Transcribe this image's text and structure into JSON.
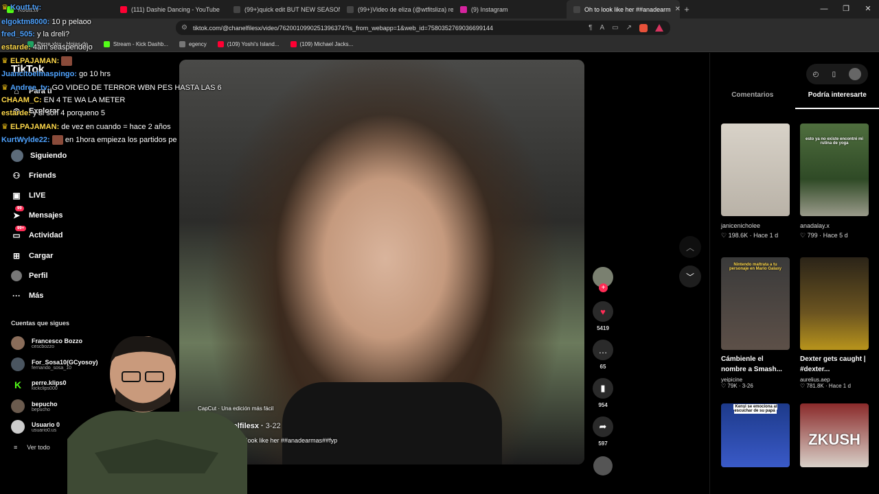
{
  "browser": {
    "tabs": [
      {
        "label": "Koutt.tv",
        "color": "#53fc18",
        "active": false
      },
      {
        "label": "(111) Dashie Dancing - YouTube",
        "color": "#ff0033",
        "active": false
      },
      {
        "label": "(99+)quick edit BUT NEW SEASON IS",
        "color": "#111111",
        "active": false
      },
      {
        "label": "(99+)Video de eliza (@wtfitsliza) relo",
        "color": "#111111",
        "active": false
      },
      {
        "label": "(9) Instagram",
        "color": "#d6249f",
        "active": false
      },
      {
        "label": "Oh to look like her ##anadearm",
        "color": "#111111",
        "active": true
      }
    ],
    "new_tab": "+",
    "window_controls": [
      "—",
      "❐",
      "✕"
    ],
    "url": "tiktok.com/@chanelfilesx/video/7620010990251396374?is_from_webapp=1&web_id=7580352769036699144",
    "bookmarks": [
      {
        "label": "Perre.xlsx - Hojas de...",
        "color": "#1fa463"
      },
      {
        "label": "Stream - Kick Dashb...",
        "color": "#53fc18"
      },
      {
        "label": "egency",
        "color": "#777777"
      },
      {
        "label": "(109) Yoshi's Island...",
        "color": "#ff0033"
      },
      {
        "label": "(109) Michael Jacks...",
        "color": "#ff0033"
      }
    ]
  },
  "tiktok": {
    "logo": "TikTok",
    "nav": [
      {
        "label": "Para ti",
        "icon": "home-icon",
        "glyph": "⌂"
      },
      {
        "label": "Explorar",
        "icon": "compass-icon",
        "glyph": "◎"
      },
      {
        "label": "Siguiendo",
        "icon": "avatar-icon",
        "glyph": "●"
      },
      {
        "label": "Friends",
        "icon": "friends-icon",
        "glyph": "⚇"
      },
      {
        "label": "LIVE",
        "icon": "live-icon",
        "glyph": "▣"
      },
      {
        "label": "Mensajes",
        "icon": "paper-plane-icon",
        "glyph": "➤",
        "badge": "99"
      },
      {
        "label": "Actividad",
        "icon": "inbox-icon",
        "glyph": "▭",
        "badge": "99+"
      },
      {
        "label": "Cargar",
        "icon": "upload-icon",
        "glyph": "⊞"
      },
      {
        "label": "Perfil",
        "icon": "profile-icon",
        "glyph": "●"
      },
      {
        "label": "Más",
        "icon": "more-icon",
        "glyph": "···"
      }
    ],
    "following_label": "Cuentas que sigues",
    "accounts": [
      {
        "name": "Francesco Bozzo",
        "handle": "cescbozzo"
      },
      {
        "name": "For_Sosa10(GCyosoy)",
        "handle": "fernando_sosa_10"
      },
      {
        "name": "perre.klips0",
        "handle": "kickclips000"
      },
      {
        "name": "bepucho",
        "handle": "bepucho"
      },
      {
        "name": "Usuario 0",
        "handle": "usuario0.us"
      }
    ],
    "see_all": "Ver todo",
    "video": {
      "capcut": "CapCut · Una edición más fácil",
      "author": "chanelfilesx",
      "date": "3-22",
      "description": "Oh to look like her ##anadearmas##fyp"
    },
    "actions": {
      "likes": "5419",
      "comments": "65",
      "saves": "954",
      "shares": "597"
    },
    "right_tabs": [
      "Comentarios",
      "Podría interesarte"
    ],
    "recommendations": [
      {
        "author": "janicenicholee",
        "likes": "198.6K",
        "age": "Hace 1 d",
        "title": "",
        "overlay": ""
      },
      {
        "author": "anadalay.x",
        "likes": "799",
        "age": "Hace 5 d",
        "title": "",
        "overlay": "esto ya no existe encontré mi rutina de yoga"
      },
      {
        "author": "yeipicine",
        "likes": "79K",
        "age": "3-26",
        "title": "Cámbienle el nombre a Smash...",
        "overlay": "Nintendo maltrata a tu personaje en Mario Galaxy"
      },
      {
        "author": "aurelius.aep",
        "likes": "781.8K",
        "age": "Hace 1 d",
        "title": "Dexter gets caught | #dexter...",
        "overlay": ""
      },
      {
        "author": "",
        "likes": "",
        "age": "",
        "title": "",
        "overlay": "Kenyi se emociona al escuchar de su papá"
      },
      {
        "author": "",
        "likes": "",
        "age": "",
        "title": "",
        "overlay": "ZKUSH"
      }
    ]
  },
  "chat": [
    {
      "user": "Koutt.tv:",
      "text": "",
      "color": "blue"
    },
    {
      "user": "elgoktm8000:",
      "text": "10 p pelaoo",
      "color": "blue"
    },
    {
      "user": "fred_505:",
      "text": "y la dreli?",
      "color": "blue"
    },
    {
      "user": "estarde:",
      "text": "4am seaspendejo",
      "color": "yellow"
    },
    {
      "user": "ELPAJAMAN:",
      "text": "",
      "color": "yellow"
    },
    {
      "user": "Juancitoelmaspingo:",
      "text": "go 10 hrs",
      "color": "blue"
    },
    {
      "user": "Andree_tv:",
      "text": "GO VIDEO DE TERROR WBN PES HASTA LAS 6",
      "color": "blue"
    },
    {
      "user": "CHAAM_C:",
      "text": "EN 4 TE WA LA METER",
      "color": "yellow"
    },
    {
      "user": "estarde:",
      "text": "y si son 4 porqueno 5",
      "color": "yellow"
    },
    {
      "user": "ELPAJAMAN:",
      "text": "de vez en cuando = hace 2 años",
      "color": "yellow"
    },
    {
      "user": "KurtWylde22:",
      "text": "en 1hora empieza los partidos pe",
      "color": "blue"
    }
  ]
}
